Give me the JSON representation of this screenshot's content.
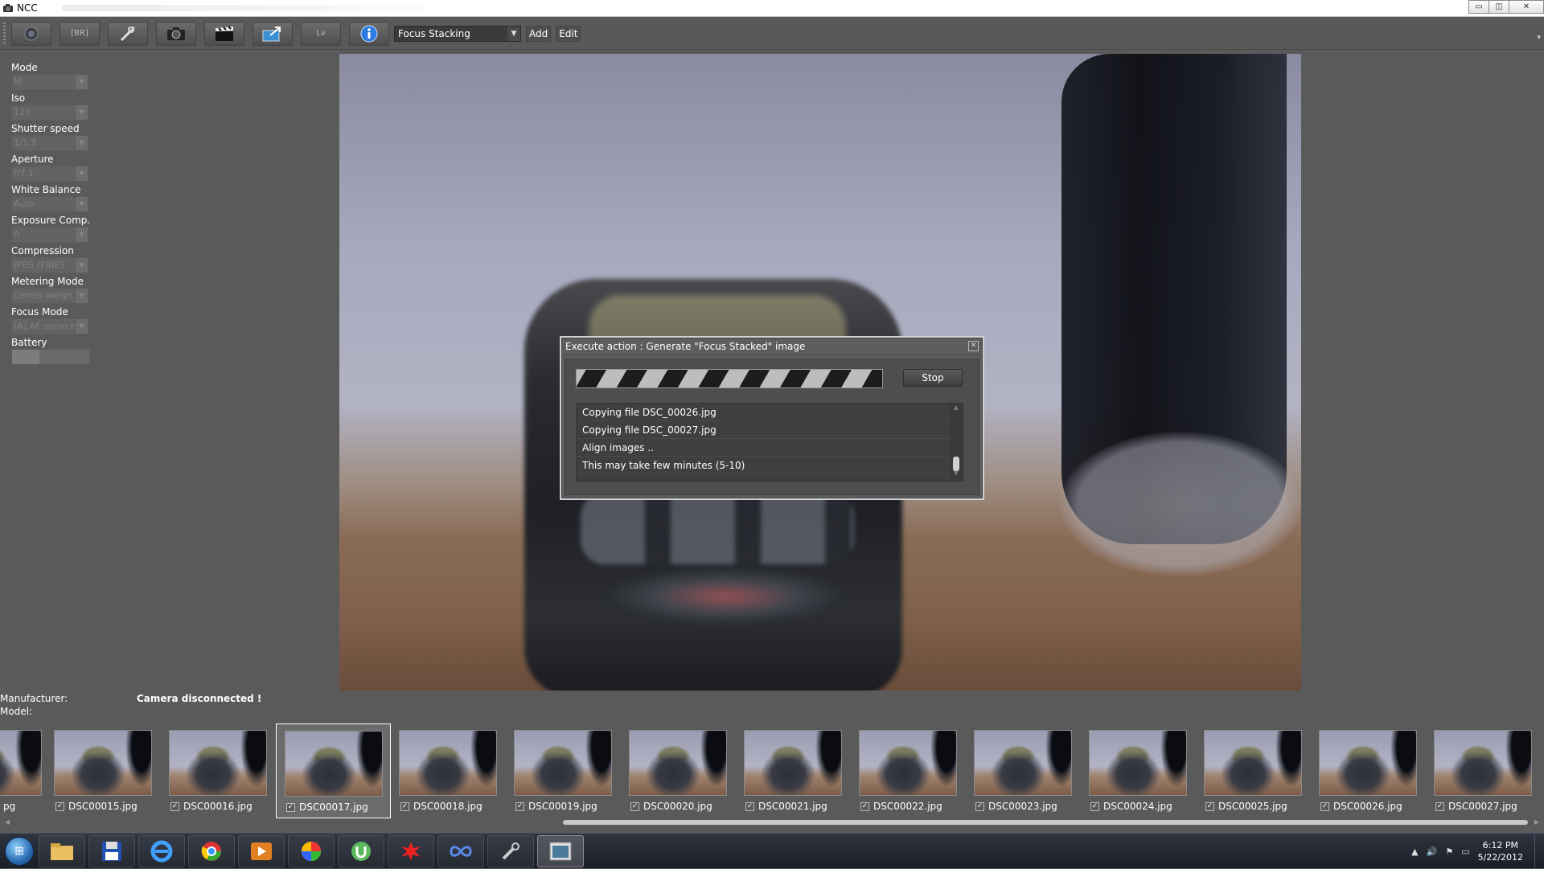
{
  "window": {
    "title": "NCC",
    "minimize_glyph": "▭",
    "restore_glyph": "◫",
    "close_glyph": "✕"
  },
  "toolbar": {
    "bracket_label": "[BR]",
    "liveview_label": "Lv",
    "action_select": "Focus Stacking",
    "add_label": "Add",
    "edit_label": "Edit"
  },
  "camera_properties": [
    {
      "label": "Mode",
      "value": "M"
    },
    {
      "label": "Iso",
      "value": "125"
    },
    {
      "label": "Shutter speed",
      "value": "1/1.3"
    },
    {
      "label": "Aperture",
      "value": "f/7.1"
    },
    {
      "label": "White Balance",
      "value": "Auto"
    },
    {
      "label": "Exposure Comp.",
      "value": "0"
    },
    {
      "label": "Compression",
      "value": "JPEG (FINE)"
    },
    {
      "label": "Metering Mode",
      "value": "Center-weigh"
    },
    {
      "label": "Focus Mode",
      "value": "[A] AF servo n"
    }
  ],
  "battery": {
    "label": "Battery",
    "level": 0.35
  },
  "dialog": {
    "title": "Execute action : Generate \"Focus Stacked\" image",
    "stop_label": "Stop",
    "log": [
      "Copying file DSC_00026.jpg",
      "Copying file DSC_00027.jpg",
      "Align images ..",
      "This may take few minutes (5-10)"
    ]
  },
  "info": {
    "manufacturer_label": "Manufacturer:",
    "model_label": "Model:",
    "status": "Camera disconnected !"
  },
  "filmstrip": {
    "first_partial": "pg",
    "files": [
      "DSC00015.jpg",
      "DSC00016.jpg",
      "DSC00017.jpg",
      "DSC00018.jpg",
      "DSC00019.jpg",
      "DSC00020.jpg",
      "DSC00021.jpg",
      "DSC00022.jpg",
      "DSC00023.jpg",
      "DSC00024.jpg",
      "DSC00025.jpg",
      "DSC00026.jpg",
      "DSC00027.jpg"
    ],
    "selected": "DSC00017.jpg"
  },
  "taskbar": {
    "time": "6:12 PM",
    "date": "5/22/2012"
  }
}
